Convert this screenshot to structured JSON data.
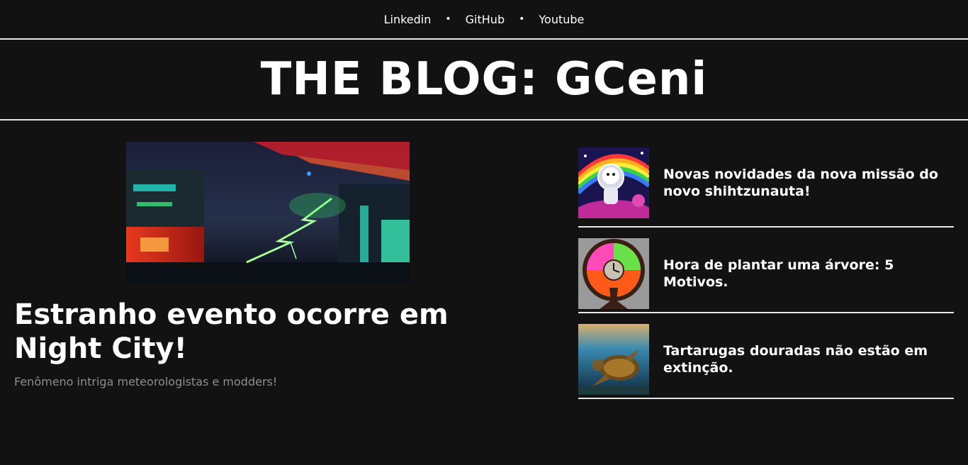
{
  "nav": {
    "links": [
      "Linkedin",
      "GitHub",
      "Youtube"
    ],
    "separator": "•"
  },
  "header": {
    "title": "THE BLOG: GCeni"
  },
  "featured": {
    "title": "Estranho evento ocorre em Night City!",
    "subtitle": "Fenômeno intriga meteorologistas e modders!",
    "image_icon": "cyberpunk-lightning-image"
  },
  "side_posts": [
    {
      "title": "Novas novidades da nova missão do novo shihtzunauta!",
      "image_icon": "astronaut-dog-image"
    },
    {
      "title": "Hora de plantar uma árvore: 5 Motivos.",
      "image_icon": "tree-clock-image"
    },
    {
      "title": "Tartarugas douradas não estão em extinção.",
      "image_icon": "sea-turtle-image"
    }
  ],
  "colors": {
    "background": "#121212",
    "text": "#ffffff",
    "muted": "#8e8e8e",
    "divider": "#e6e6e6"
  }
}
